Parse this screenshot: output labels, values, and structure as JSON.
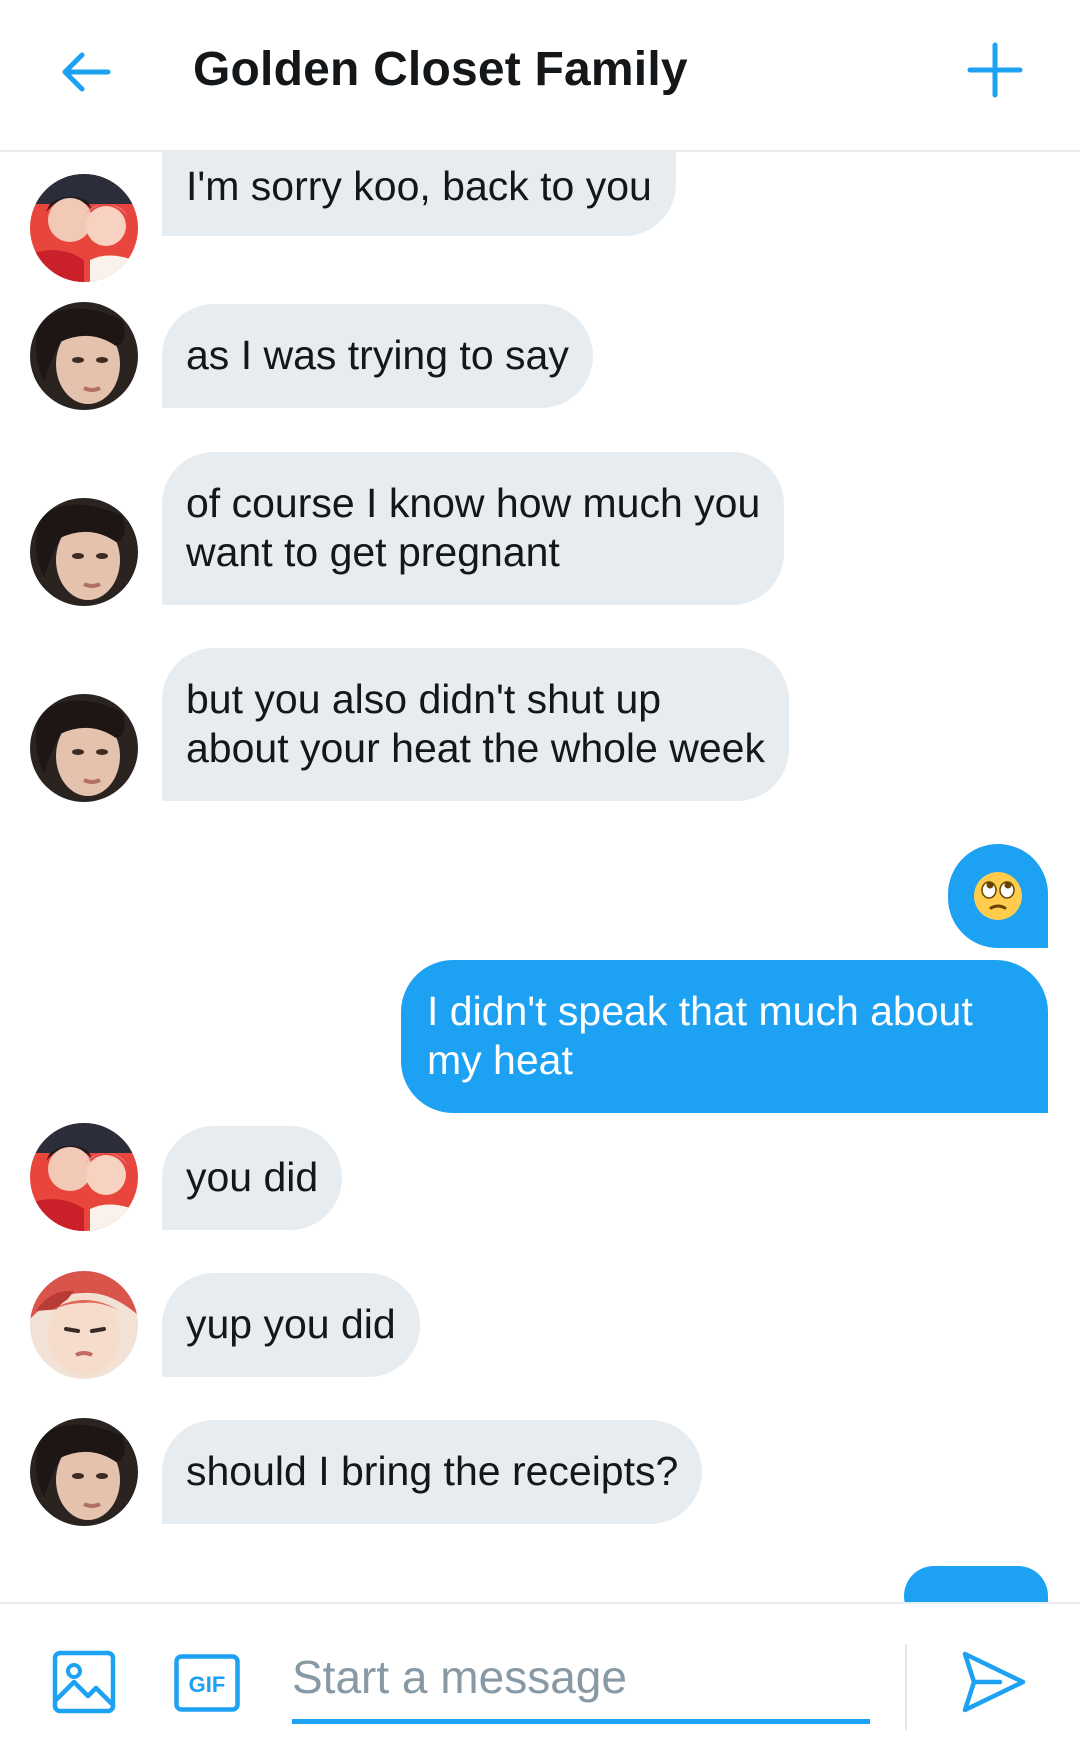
{
  "header": {
    "title": "Golden Closet Family",
    "back_icon": "arrow-left-icon",
    "add_icon": "plus-icon",
    "accent_color": "#1da1f2"
  },
  "messages": [
    {
      "direction": "incoming",
      "sender_avatar": "avatar-couple-red",
      "lines": [
        "I'm sorry koo, back to you"
      ]
    },
    {
      "direction": "incoming",
      "sender_avatar": "avatar-dark-hair",
      "lines": [
        "as I was trying to say"
      ]
    },
    {
      "direction": "incoming",
      "sender_avatar": "avatar-dark-hair",
      "lines": [
        "of course I know how much you",
        "want to get pregnant"
      ]
    },
    {
      "direction": "incoming",
      "sender_avatar": "avatar-dark-hair",
      "lines": [
        "but you also didn't shut up",
        "about your heat the whole week"
      ]
    },
    {
      "direction": "outgoing",
      "emoji": "face-with-rolling-eyes-icon"
    },
    {
      "direction": "outgoing",
      "lines": [
        "I didn't speak that much about",
        "my heat"
      ]
    },
    {
      "direction": "incoming",
      "sender_avatar": "avatar-couple-red",
      "lines": [
        "you did"
      ]
    },
    {
      "direction": "incoming",
      "sender_avatar": "avatar-red-hair",
      "lines": [
        "yup you did"
      ]
    },
    {
      "direction": "incoming",
      "sender_avatar": "avatar-dark-hair",
      "lines": [
        "should I bring the receipts?"
      ]
    }
  ],
  "composer": {
    "placeholder": "Start a message",
    "value": "",
    "media_icon": "image-icon",
    "gif_label": "GIF",
    "send_icon": "send-icon"
  },
  "colors": {
    "incoming_bubble": "#e6ecf0",
    "outgoing_bubble": "#1da1f2",
    "text": "#14171a",
    "placeholder": "#8899a6"
  }
}
